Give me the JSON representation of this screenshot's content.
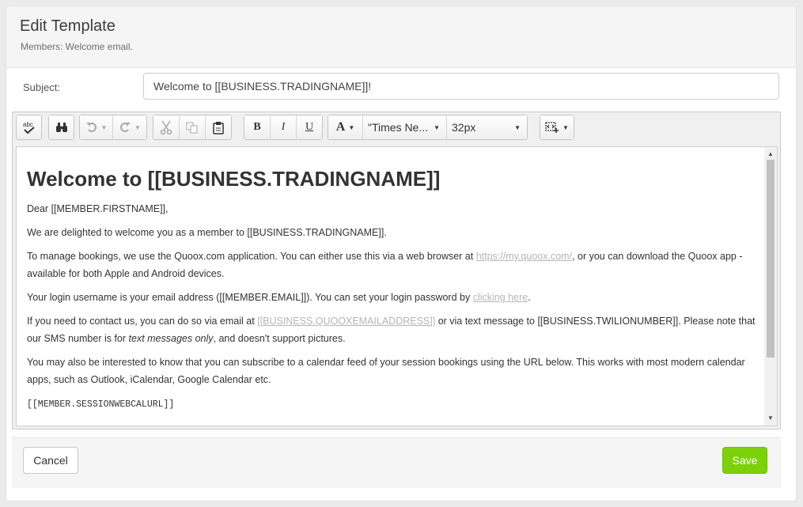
{
  "header": {
    "title": "Edit Template",
    "subtitle": "Members: Welcome email."
  },
  "subject": {
    "label": "Subject:",
    "value": "Welcome to [[BUSINESS.TRADINGNAME]]!"
  },
  "toolbar": {
    "spellcheck_text": "abc",
    "font_family": "\"Times Ne...",
    "font_size": "32px",
    "bold": "B",
    "italic": "I",
    "underline": "U",
    "font_color": "A",
    "icons": [
      "spellcheck-icon",
      "find-icon",
      "undo-icon",
      "redo-icon",
      "cut-icon",
      "copy-icon",
      "paste-icon",
      "bold-icon",
      "italic-icon",
      "underline-icon",
      "font-color-icon",
      "insert-snippet-icon"
    ]
  },
  "document": {
    "heading": "Welcome to [[BUSINESS.TRADINGNAME]]",
    "p1": "Dear [[MEMBER.FIRSTNAME]],",
    "p2": "We are delighted to welcome you as a member to [[BUSINESS.TRADINGNAME]].",
    "p3_a": "To manage bookings, we use the Quoox.com application. You can either use this via a web browser at ",
    "p3_link": "https://my.quoox.com/",
    "p3_b": ", or you can download the Quoox app - available for both Apple and Android devices.",
    "p4_a": "Your login username is your email address ([[MEMBER.EMAIL]]). You can set your login password by ",
    "p4_link": "clicking here",
    "p4_b": ".",
    "p5_a": "If you need to contact us, you can do so via email at ",
    "p5_link": "[[BUSINESS.QUOOXEMAILADDRESS]]",
    "p5_b": " or via text message to [[BUSINESS.TWILIONUMBER]]. Please note that our SMS number is for ",
    "p5_em": "text messages only",
    "p5_c": ", and doesn't support pictures.",
    "p6": "You may also be interested to know that you can subscribe to a calendar feed of your session bookings using the URL below. This works with most modern calendar apps, such as Outlook, iCalendar, Google Calendar etc.",
    "p7": "[[MEMBER.SESSIONWEBCALURL]]"
  },
  "footer": {
    "cancel_label": "Cancel",
    "save_label": "Save"
  },
  "colors": {
    "save": "#7dd10b",
    "link": "#b5b5b5",
    "header_bg": "#f5f5f5"
  }
}
